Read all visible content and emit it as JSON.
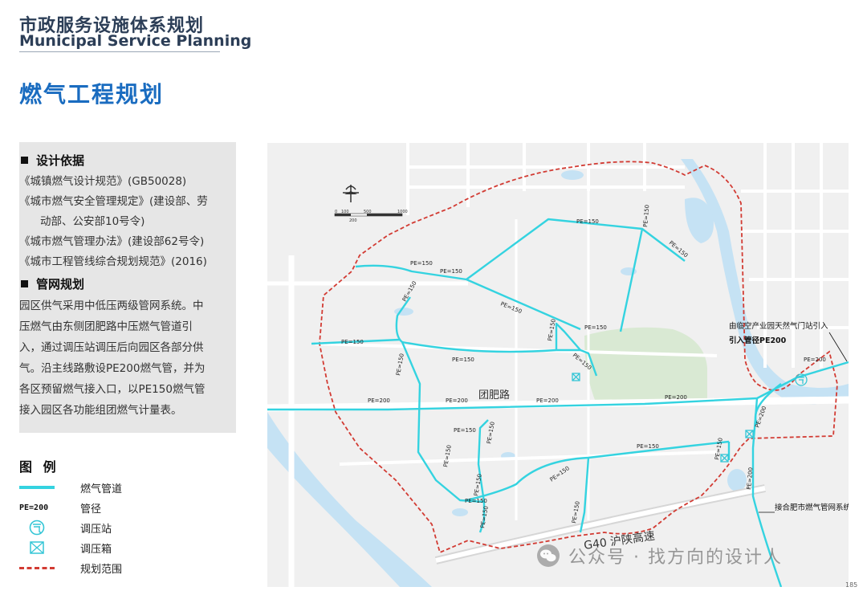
{
  "header": {
    "title_cn": "市政服务设施体系规划",
    "title_en": "Municipal Service Planning"
  },
  "section_title": "燃气工程规划",
  "panel": {
    "basis_heading": "设计依据",
    "refs": [
      "《城镇燃气设计规范》(GB50028)",
      "《城市燃气安全管理规定》(建设部、劳",
      "动部、公安部10号令)",
      "《城市燃气管理办法》(建设部62号令)",
      "《城市工程管线综合规划规范》(2016)"
    ],
    "network_heading": "管网规划",
    "network_lines": [
      "园区供气采用中低压两级管网系统。中",
      "压燃气由东侧团肥路中压燃气管道引",
      "入，通过调压站调压后向园区各部分供",
      "气。沿主线路敷设PE200燃气管，并为",
      "各区预留燃气接入口，以PE150燃气管",
      "接入园区各功能组团燃气计量表。"
    ]
  },
  "legend": {
    "title": "图 例",
    "items": [
      {
        "symbol": "line",
        "label": "燃气管道"
      },
      {
        "symbol": "pe",
        "symbol_text": "PE=200",
        "label": "管径"
      },
      {
        "symbol": "station",
        "label": "调压站"
      },
      {
        "symbol": "box",
        "label": "调压箱"
      },
      {
        "symbol": "dash",
        "label": "规划范围"
      }
    ]
  },
  "map": {
    "colors": {
      "pipe": "#34d3e0",
      "boundary": "#d23b33",
      "green": "#d9e9d3",
      "water": "#c5e2f4",
      "road": "#ffffff",
      "land": "#f0f0f0"
    },
    "road_labels": {
      "tuanfei": "团肥路",
      "g40": "G40 沪陕高速"
    },
    "annotations": {
      "source_line1": "由临空产业园天然气门站引入",
      "source_line2": "引入管径PE200",
      "connect": "接合肥市燃气管网系统"
    },
    "scale_ticks": [
      "0",
      "100",
      "200",
      "500",
      "1000"
    ],
    "pe150": "PE=150",
    "pe200": "PE=200"
  },
  "watermark": "公众号 · 找方向的设计人",
  "page_number": "185"
}
